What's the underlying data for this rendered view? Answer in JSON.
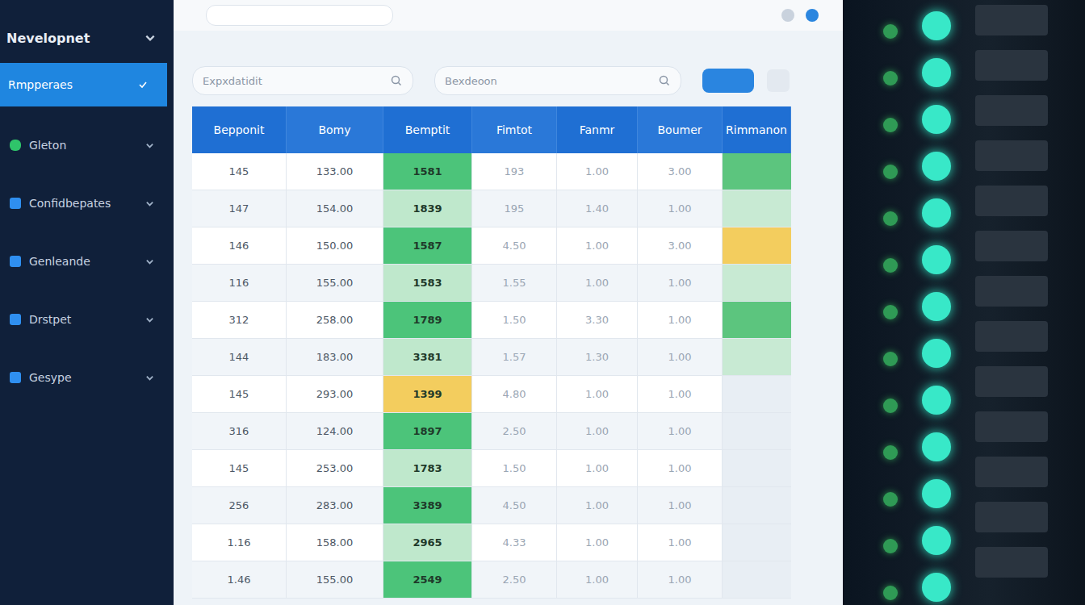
{
  "sidebar": {
    "title": "Nevelopnet",
    "items": [
      {
        "label": "Rmpperaes",
        "selected": true
      },
      {
        "label": "Gleton",
        "selected": false
      },
      {
        "label": "Confidbepates",
        "selected": false
      },
      {
        "label": "Genleande",
        "selected": false
      },
      {
        "label": "Drstpet",
        "selected": false
      },
      {
        "label": "Gesype",
        "selected": false
      }
    ]
  },
  "search": [
    {
      "placeholder": "Expxdatidit"
    },
    {
      "placeholder": "Bexdeoon"
    }
  ],
  "table": {
    "columns": [
      "Bepponit",
      "Bomy",
      "Bemptit",
      "Fimtot",
      "Fanmr",
      "Boumer",
      "Rimmanon"
    ],
    "rows": [
      {
        "cells": [
          "145",
          "133.00",
          "1581",
          "193",
          "1.00",
          "3.00"
        ],
        "mark_color": "#4cc47a",
        "status_color": "#5cc57e"
      },
      {
        "cells": [
          "147",
          "154.00",
          "1839",
          "195",
          "1.40",
          "1.00"
        ],
        "mark_color": "#bfe8cc",
        "status_color": "#c8ead3"
      },
      {
        "cells": [
          "146",
          "150.00",
          "1587",
          "4.50",
          "1.00",
          "3.00"
        ],
        "mark_color": "#4cc47a",
        "status_color": "#f3cd5e"
      },
      {
        "cells": [
          "116",
          "155.00",
          "1583",
          "1.55",
          "1.00",
          "1.00"
        ],
        "mark_color": "#bfe8cc",
        "status_color": "#c8ead3"
      },
      {
        "cells": [
          "312",
          "258.00",
          "1789",
          "1.50",
          "3.30",
          "1.00"
        ],
        "mark_color": "#4cc47a",
        "status_color": "#5cc57e"
      },
      {
        "cells": [
          "144",
          "183.00",
          "3381",
          "1.57",
          "1.30",
          "1.00"
        ],
        "mark_color": "#bfe8cc",
        "status_color": "#c8ead3"
      },
      {
        "cells": [
          "145",
          "293.00",
          "1399",
          "4.80",
          "1.00",
          "1.00"
        ],
        "mark_color": "#f3cd5e",
        "status_color": "#e8eef4"
      },
      {
        "cells": [
          "316",
          "124.00",
          "1897",
          "2.50",
          "1.00",
          "1.00"
        ],
        "mark_color": "#4cc47a",
        "status_color": "#e8eef4"
      },
      {
        "cells": [
          "145",
          "253.00",
          "1783",
          "1.50",
          "1.00",
          "1.00"
        ],
        "mark_color": "#bfe8cc",
        "status_color": "#e8eef4"
      },
      {
        "cells": [
          "256",
          "283.00",
          "3389",
          "4.50",
          "1.00",
          "1.00"
        ],
        "mark_color": "#4cc47a",
        "status_color": "#e8eef4"
      },
      {
        "cells": [
          "1.16",
          "158.00",
          "2965",
          "4.33",
          "1.00",
          "1.00"
        ],
        "mark_color": "#bfe8cc",
        "status_color": "#e8eef4"
      },
      {
        "cells": [
          "1.46",
          "155.00",
          "2549",
          "2.50",
          "1.00",
          "1.00"
        ],
        "mark_color": "#4cc47a",
        "status_color": "#e8eef4"
      }
    ]
  }
}
